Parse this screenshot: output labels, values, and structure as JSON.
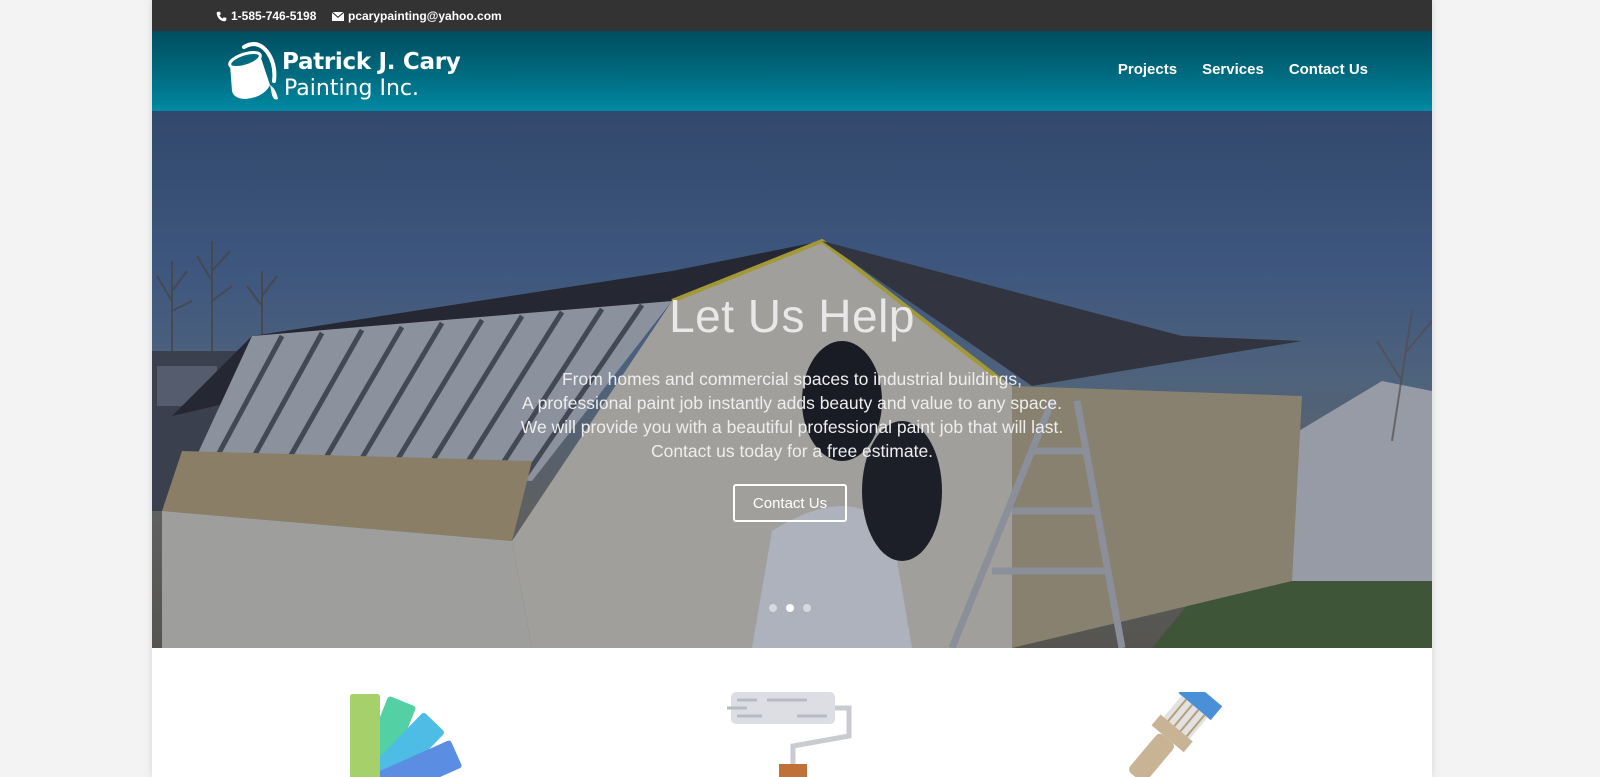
{
  "topbar": {
    "phone": "1-585-746-5198",
    "email": "pcarypainting@yahoo.com",
    "phone_icon": "phone-icon",
    "email_icon": "envelope-icon"
  },
  "logo": {
    "line1": "Patrick J. Cary",
    "line2": "Painting Inc.",
    "icon": "paint-bucket-icon"
  },
  "nav": {
    "items": [
      "Projects",
      "Services",
      "Contact Us"
    ]
  },
  "hero": {
    "title": "Let Us Help",
    "lines": [
      "From homes and commercial spaces to industrial buildings,",
      "A professional paint job instantly adds beauty and value to any space.",
      "We will provide you with a beautiful professional paint job that will last.",
      "Contact us today for a free estimate."
    ],
    "button_label": "Contact Us",
    "slides_total": 3,
    "active_slide": 2
  },
  "features": {
    "icons": [
      "color-swatch-icon",
      "paint-roller-icon",
      "paint-brush-icon"
    ]
  },
  "colors": {
    "topbar_bg": "#333333",
    "header_top": "#004d5f",
    "header_bottom": "#0089a3",
    "page_bg": "#f3f3f3"
  }
}
